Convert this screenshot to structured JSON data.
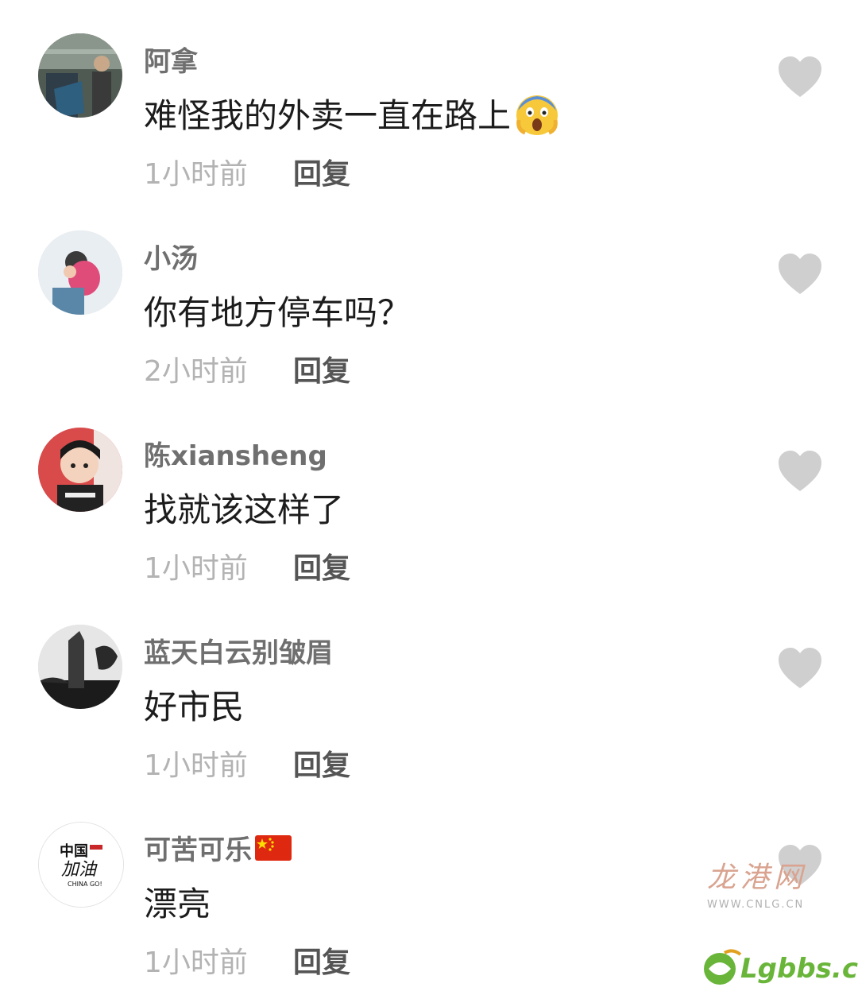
{
  "comments": [
    {
      "username": "阿拿",
      "text": "难怪我的外卖一直在路上",
      "emoji": "face-screaming-in-fear",
      "time": "1小时前",
      "reply": "回复"
    },
    {
      "username": "小汤",
      "text": "你有地方停车吗？",
      "time": "2小时前",
      "reply": "回复"
    },
    {
      "username": "陈xiansheng",
      "text": "找就该这样了",
      "time": "1小时前",
      "reply": "回复"
    },
    {
      "username": "蓝天白云别皱眉",
      "text": "好市民",
      "time": "1小时前",
      "reply": "回复"
    },
    {
      "username": "可苦可乐",
      "flag": "china-flag",
      "text": "漂亮",
      "time": "1小时前",
      "reply": "回复"
    }
  ],
  "watermarks": {
    "cnlg_cn": "龙港网",
    "cnlg_url": "WWW.CNLG.CN",
    "lgbbs": "Lgbbs.cn"
  },
  "avatar_logo": {
    "line1": "中国",
    "line2": "加油",
    "line3": "CHINA GO!"
  },
  "colors": {
    "like_icon": "#cfcfcf",
    "username": "#6f6f6f",
    "time": "#b3b3b3"
  }
}
